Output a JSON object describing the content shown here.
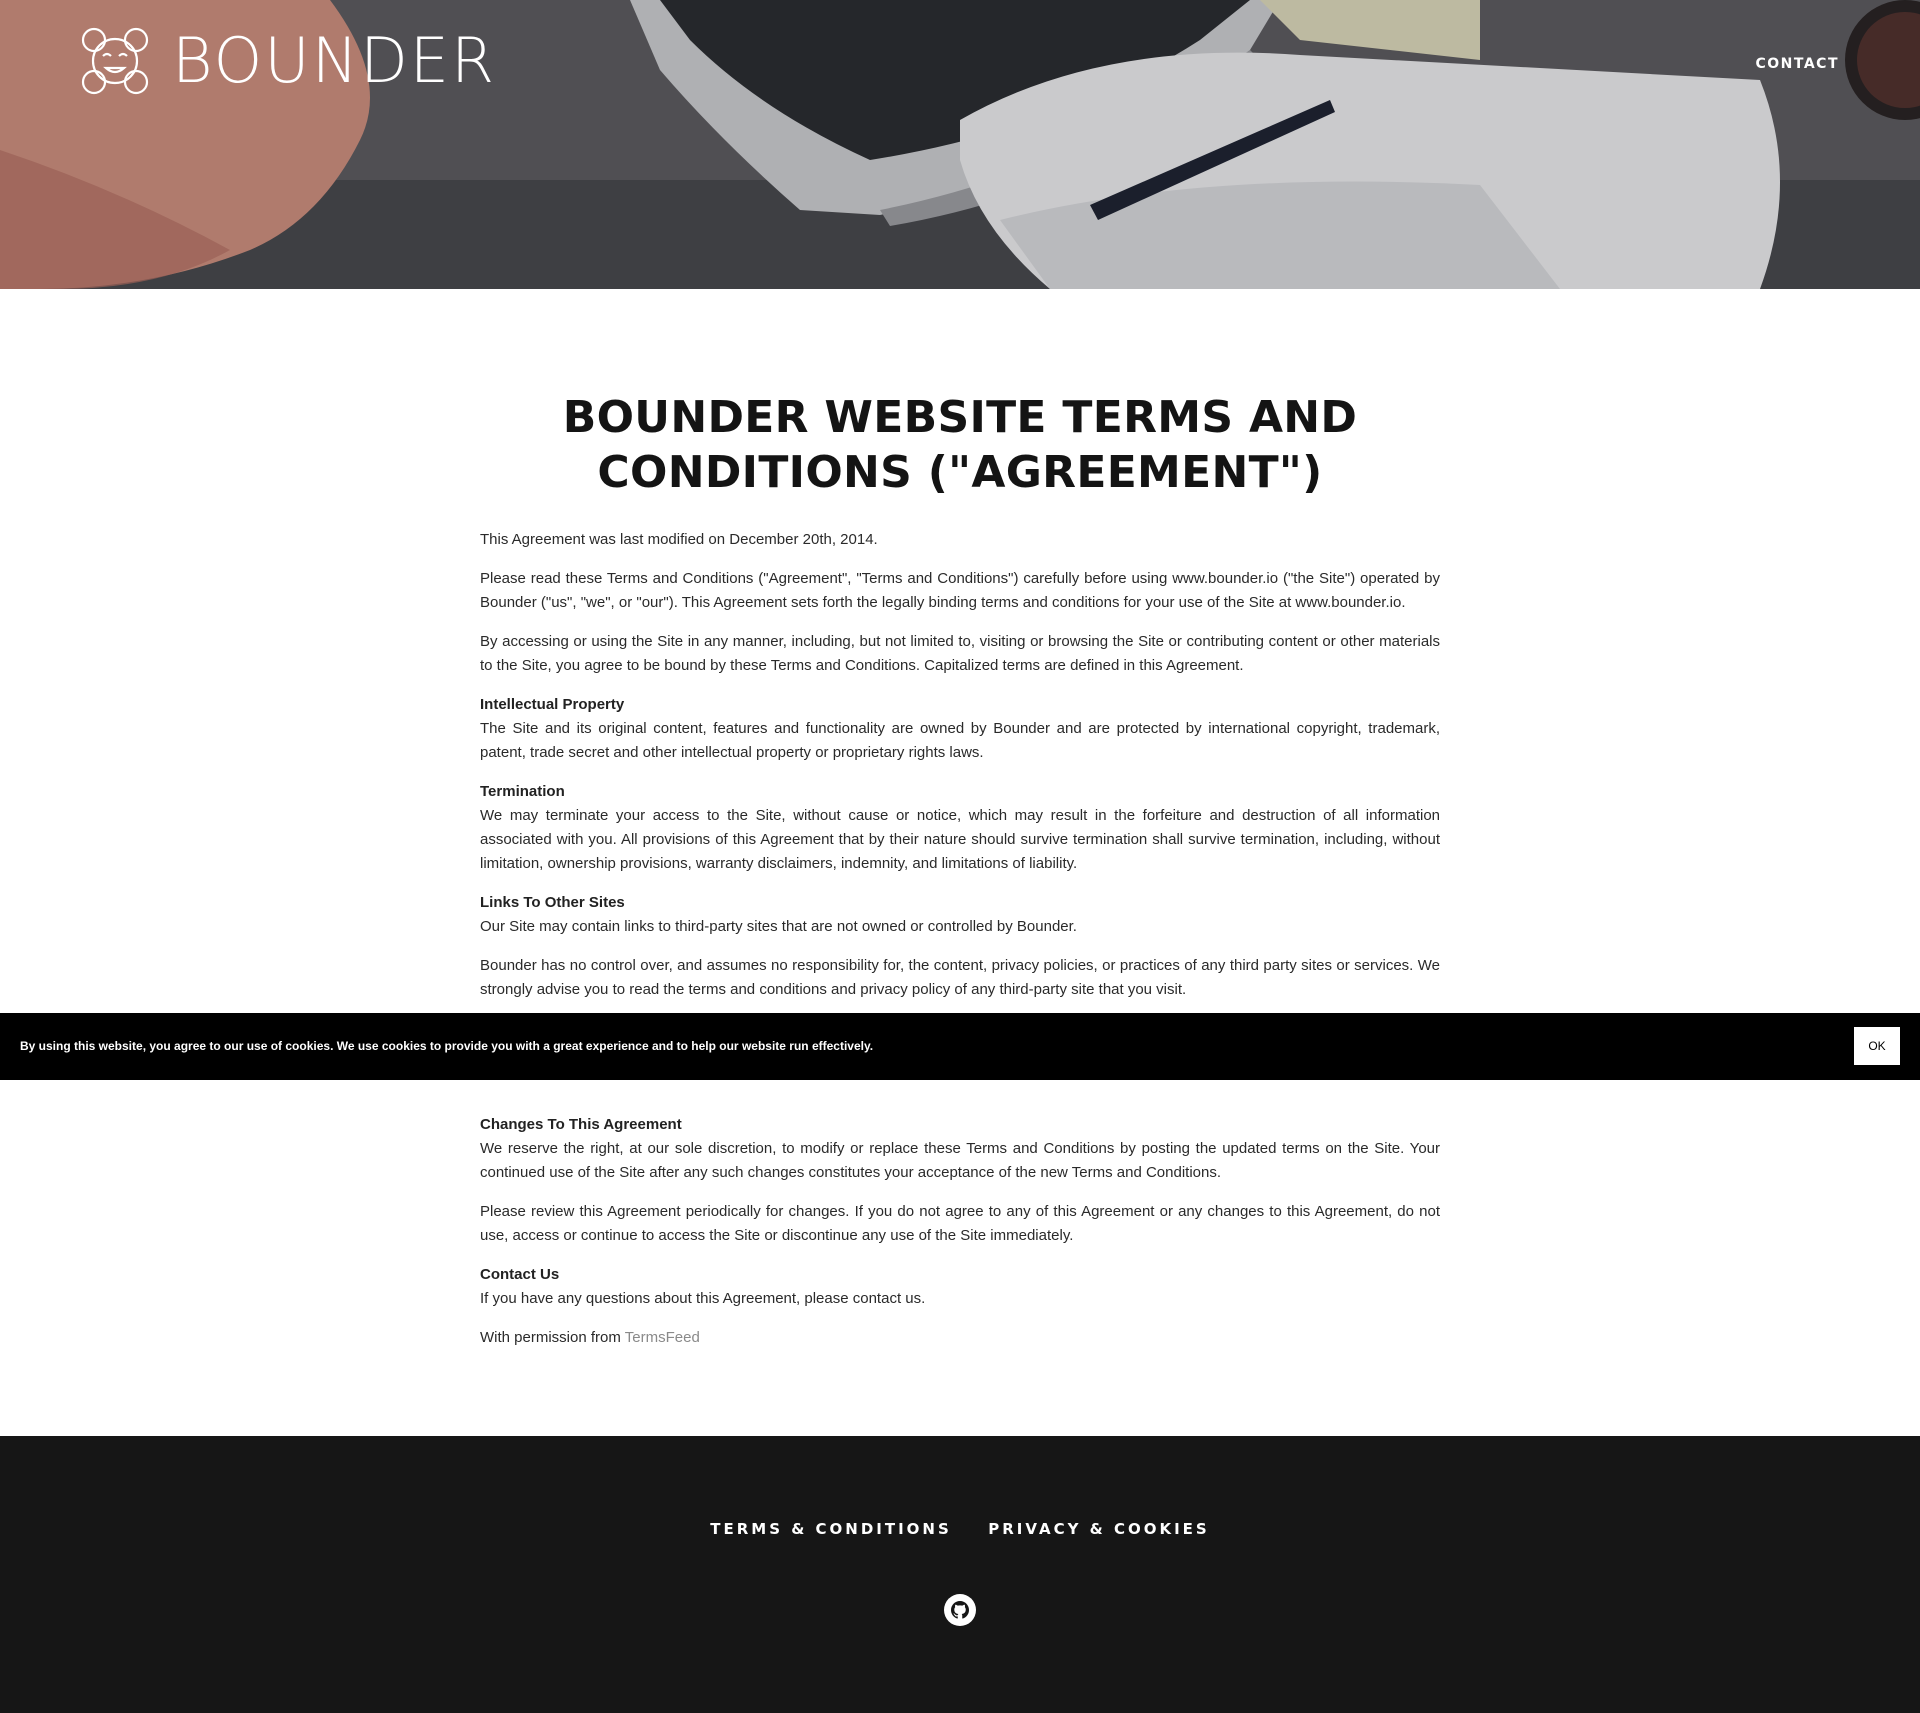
{
  "header": {
    "brand": "BOUNDER",
    "nav_contact": "CONTACT"
  },
  "main": {
    "title": "BOUNDER WEBSITE TERMS AND CONDITIONS (\"AGREEMENT\")",
    "last_modified": "This Agreement was last modified on December 20th, 2014.",
    "intro_1": "Please read these Terms and Conditions (\"Agreement\", \"Terms and Conditions\") carefully before using www.bounder.io (\"the Site\") operated by Bounder (\"us\", \"we\", or \"our\"). This Agreement sets forth the legally binding terms and conditions for your use of the Site at www.bounder.io.",
    "intro_2": "By accessing or using the Site in any manner, including, but not limited to, visiting or browsing the Site or contributing content or other materials to the Site, you agree to be bound by these Terms and Conditions. Capitalized terms are defined in this Agreement.",
    "ip_heading": "Intellectual Property",
    "ip_text": "The Site and its original content, features and functionality are owned by Bounder and are protected by international copyright, trademark, patent, trade secret and other intellectual property or proprietary rights laws.",
    "termination_heading": "Termination",
    "termination_text": "We may terminate your access to the Site, without cause or notice, which may result in the forfeiture and destruction of all information associated with you. All provisions of this Agreement that by their nature should survive termination shall survive termination, including, without limitation, ownership provisions, warranty disclaimers, indemnity, and limitations of liability.",
    "links_heading": "Links To Other Sites",
    "links_text": "Our Site may contain links to third-party sites that are not owned or controlled by Bounder.",
    "links_text_2": "Bounder has no control over, and assumes no responsibility for, the content, privacy policies, or practices of any third party sites or services. We strongly advise you to read the terms and conditions and privacy policy of any third-party site that you visit.",
    "changes_heading": "Changes To This Agreement",
    "changes_text": "We reserve the right, at our sole discretion, to modify or replace these Terms and Conditions by posting the updated terms on the Site. Your continued use of the Site after any such changes constitutes your acceptance of the new Terms and Conditions.",
    "changes_text_2": "Please review this Agreement periodically for changes. If you do not agree to any of this Agreement or any changes to this Agreement, do not use, access or continue to access the Site or discontinue any use of the Site immediately.",
    "contact_heading": "Contact Us",
    "contact_text": "If you have any questions about this Agreement, please contact us.",
    "permission_prefix": "With permission from",
    "permission_link": "TermsFeed"
  },
  "cookie_bar": {
    "text": "By using this website, you agree to our use of cookies. We use cookies to provide you with a great experience and to help our website run effectively.",
    "ok_label": "OK"
  },
  "footer": {
    "terms_link": "TERMS & CONDITIONS",
    "privacy_link": "PRIVACY & COOKIES",
    "github_icon": "github-icon"
  },
  "colors": {
    "footer_bg": "#161616",
    "cookie_bg": "#000000",
    "title_color": "#141414",
    "link_muted": "#8a8a8a"
  }
}
